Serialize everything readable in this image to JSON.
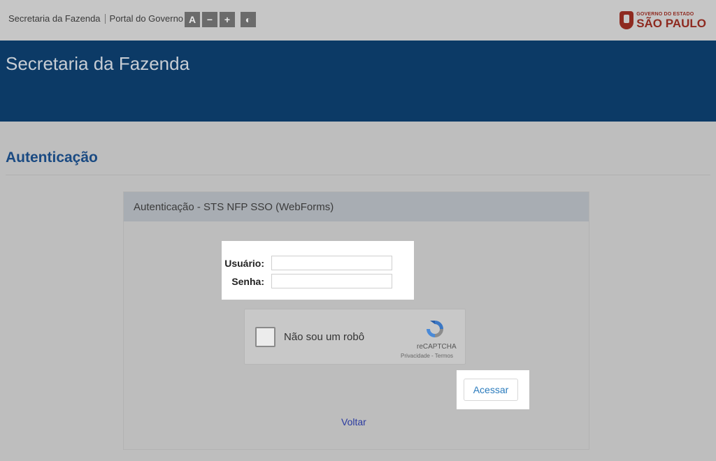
{
  "topbar": {
    "link_fazenda": "Secretaria da Fazenda",
    "link_portal": "Portal do Governo",
    "a11y": {
      "font_a": "A",
      "decrease": "−",
      "increase": "+",
      "contrast": "◐"
    }
  },
  "logo": {
    "line1": "GOVERNO DO ESTADO",
    "line2": "SÃO PAULO"
  },
  "banner": {
    "title": "Secretaria da Fazenda"
  },
  "page": {
    "title": "Autenticação"
  },
  "panel": {
    "heading": "Autenticação - STS NFP SSO (WebForms)",
    "user_label": "Usuário:",
    "user_value": "",
    "password_label": "Senha:",
    "password_value": ""
  },
  "captcha": {
    "checkbox_label": "Não sou um robô",
    "brand": "reCAPTCHA",
    "terms": "Privacidade - Termos"
  },
  "actions": {
    "submit": "Acessar",
    "back": "Voltar"
  },
  "colors": {
    "banner": "#0c3a66",
    "title": "#1a4a82",
    "logo": "#8e2a20",
    "link": "#2a3aa0"
  }
}
